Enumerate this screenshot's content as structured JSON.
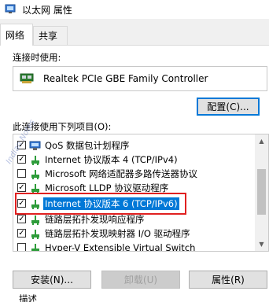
{
  "window": {
    "title": "以太网 属性",
    "icon": "network-properties-icon"
  },
  "tabs": [
    {
      "label": "网络",
      "active": true
    },
    {
      "label": "共享",
      "active": false
    }
  ],
  "connect_using_label": "连接时使用:",
  "adapter": {
    "name": "Realtek PCIe GBE Family Controller",
    "icon": "network-adapter-icon"
  },
  "configure_button": "配置(C)...",
  "items_label": "此连接使用下列项目(O):",
  "items": [
    {
      "label": "QoS 数据包计划程序",
      "checked": true,
      "icon": "qos-icon"
    },
    {
      "label": "Internet 协议版本 4 (TCP/IPv4)",
      "checked": true,
      "icon": "protocol-icon"
    },
    {
      "label": "Microsoft 网络适配器多路传送器协议",
      "checked": false,
      "icon": "protocol-icon"
    },
    {
      "label": "Microsoft LLDP 协议驱动程序",
      "checked": true,
      "icon": "protocol-icon"
    },
    {
      "label": "Internet 协议版本 6 (TCP/IPv6)",
      "checked": true,
      "selected": true,
      "icon": "protocol-icon"
    },
    {
      "label": "链路层拓扑发现响应程序",
      "checked": true,
      "icon": "protocol-icon"
    },
    {
      "label": "链路层拓扑发现映射器 I/O 驱动程序",
      "checked": true,
      "icon": "protocol-icon"
    },
    {
      "label": "Hyper-V Extensible Virtual Switch",
      "checked": false,
      "icon": "protocol-icon"
    }
  ],
  "buttons": {
    "install": "安装(N)...",
    "uninstall": "卸载(U)",
    "properties": "属性(R)"
  },
  "description_label": "描述",
  "watermark": "Indian Notes",
  "colors": {
    "selection": "#0078d7",
    "highlight_box": "#e02020"
  }
}
